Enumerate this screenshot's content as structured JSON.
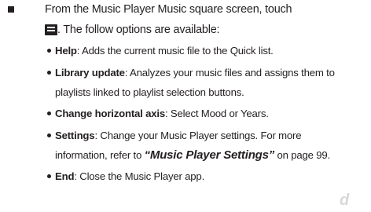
{
  "intro": {
    "line1": "From the Music Player Music square screen, touch",
    "line2": ". The follow options are available:",
    "icon": "menu-icon"
  },
  "items": [
    {
      "term": "Help",
      "text": ": Adds the current music file to the Quick list."
    },
    {
      "term": "Library update",
      "text": ": Analyzes your music files and assigns them to",
      "text2": "playlists linked to playlist selection buttons."
    },
    {
      "term": "Change horizontal axis",
      "text": ": Select Mood or Years."
    },
    {
      "term": "Settings",
      "text": ": Change your Music Player settings. For more",
      "text2a": "information, refer to ",
      "ref": "“Music Player Settings”",
      "text2b": " on page 99."
    },
    {
      "term": "End",
      "text": ": Close the Music Player app."
    }
  ],
  "watermark": "d"
}
